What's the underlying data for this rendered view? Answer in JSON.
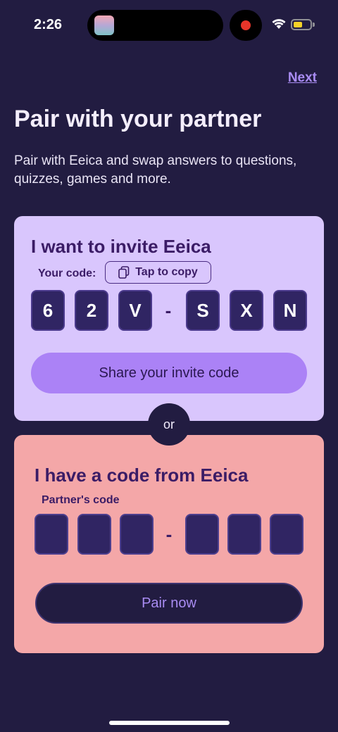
{
  "status_bar": {
    "time": "2:26",
    "battery_color": "#f6d228",
    "recording_color": "#e8352a"
  },
  "header": {
    "next_label": "Next",
    "title": "Pair with your partner",
    "subtitle": "Pair with Eeica and swap answers to questions, quizzes, games and more."
  },
  "invite": {
    "heading": "I want to invite Eeica",
    "code_label": "Your code:",
    "copy_label": "Tap to copy",
    "code": [
      "6",
      "2",
      "V",
      "S",
      "X",
      "N"
    ],
    "separator": "-",
    "share_label": "Share your invite code"
  },
  "divider": {
    "label": "or"
  },
  "join": {
    "heading": "I have a code from Eeica",
    "partner_label": "Partner's code",
    "code": [
      "",
      "",
      "",
      "",
      "",
      ""
    ],
    "separator": "-",
    "pair_label": "Pair now"
  },
  "colors": {
    "background": "#221c41",
    "invite_card": "#d9c6fd",
    "join_card": "#f4a7a8",
    "accent": "#ab82f6",
    "link": "#a98cf3"
  }
}
